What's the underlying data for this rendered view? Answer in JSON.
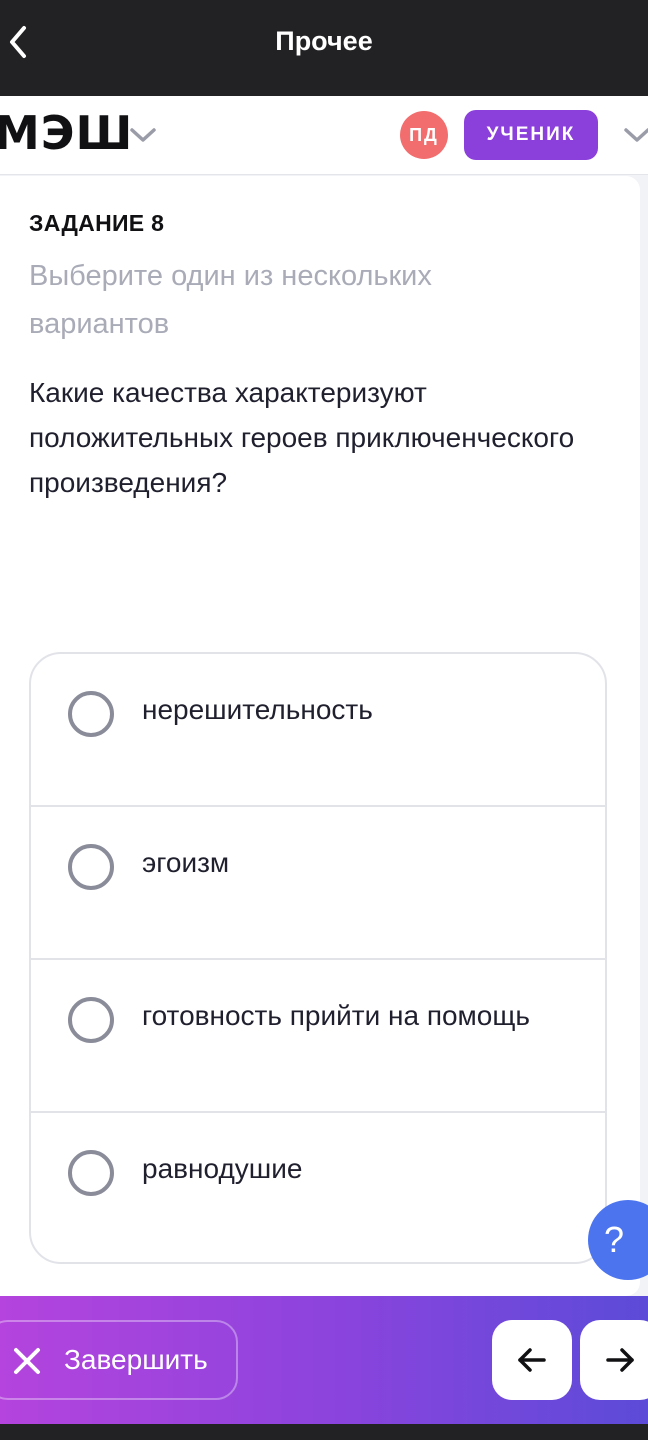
{
  "topbar": {
    "title": "Прочее"
  },
  "header": {
    "logo_text": "МЭШ",
    "avatar_initials": "ПД",
    "role_label": "УЧЕНИК"
  },
  "task": {
    "number_label": "ЗАДАНИЕ 8",
    "hint": "Выберите один из нескольких вариантов",
    "question": "Какие качества характеризуют положительных героев приключенческого произведения?",
    "options": [
      {
        "label": "нерешительность",
        "selected": false
      },
      {
        "label": "эгоизм",
        "selected": false
      },
      {
        "label": "готовность прийти на помощь",
        "selected": false
      },
      {
        "label": "равнодушие",
        "selected": false
      }
    ]
  },
  "help_button": {
    "label": "?"
  },
  "footer": {
    "finish_label": "Завершить",
    "prev_icon": "arrow-left-icon",
    "next_icon": "arrow-right-icon"
  },
  "colors": {
    "accent": "#8b3fdb",
    "avatar": "#f26d6d",
    "help": "#4b74ee",
    "gradient_start": "#b444dd",
    "gradient_end": "#5c4bd8"
  }
}
